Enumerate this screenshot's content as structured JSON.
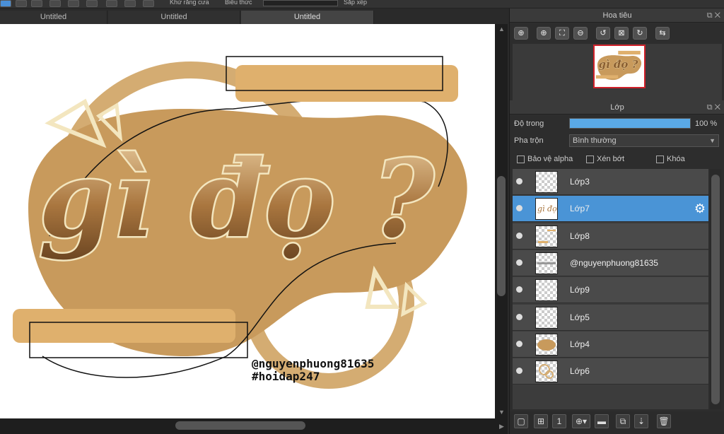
{
  "toolbar": {
    "partial_text_1": "Khử răng cưa",
    "partial_text_2": "Biểu thức",
    "partial_text_3": "Sắp xếp"
  },
  "tabs": [
    {
      "label": "Untitled",
      "active": false
    },
    {
      "label": "Untitled",
      "active": false
    },
    {
      "label": "Untitled",
      "active": true
    }
  ],
  "canvas": {
    "credit_user": "@nguyenphuong81635",
    "credit_tag": "#hoidap247",
    "lettering": "gì đọ ?"
  },
  "navigator": {
    "title": "Hoa tiêu",
    "buttons": [
      "zoom-in-icon",
      "zoom-in-icon",
      "fit-icon",
      "zoom-out-icon",
      "rotate-left-icon",
      "reset-icon",
      "rotate-right-icon",
      "flip-icon"
    ]
  },
  "layer_panel": {
    "title": "Lớp",
    "opacity_label": "Độ trong",
    "opacity_value": "100 %",
    "opacity_fraction": 1.0,
    "blend_label": "Pha trộn",
    "blend_value": "Bình thường",
    "checkbox_alpha": "Bảo vệ alpha",
    "checkbox_clip": "Xén bớt",
    "checkbox_lock": "Khóa",
    "layers": [
      {
        "name": "Lớp3",
        "selected": false
      },
      {
        "name": "Lớp7",
        "selected": true
      },
      {
        "name": "Lớp8",
        "selected": false
      },
      {
        "name": "@nguyenphuong81635",
        "selected": false
      },
      {
        "name": "Lớp9",
        "selected": false
      },
      {
        "name": "Lớp5",
        "selected": false
      },
      {
        "name": "Lớp4",
        "selected": false
      },
      {
        "name": "Lớp6",
        "selected": false
      }
    ]
  },
  "colors": {
    "accent": "#4a94d6",
    "tan": "#c89a5c",
    "cream": "#f3e6bf",
    "bar": "#dfb06d"
  }
}
